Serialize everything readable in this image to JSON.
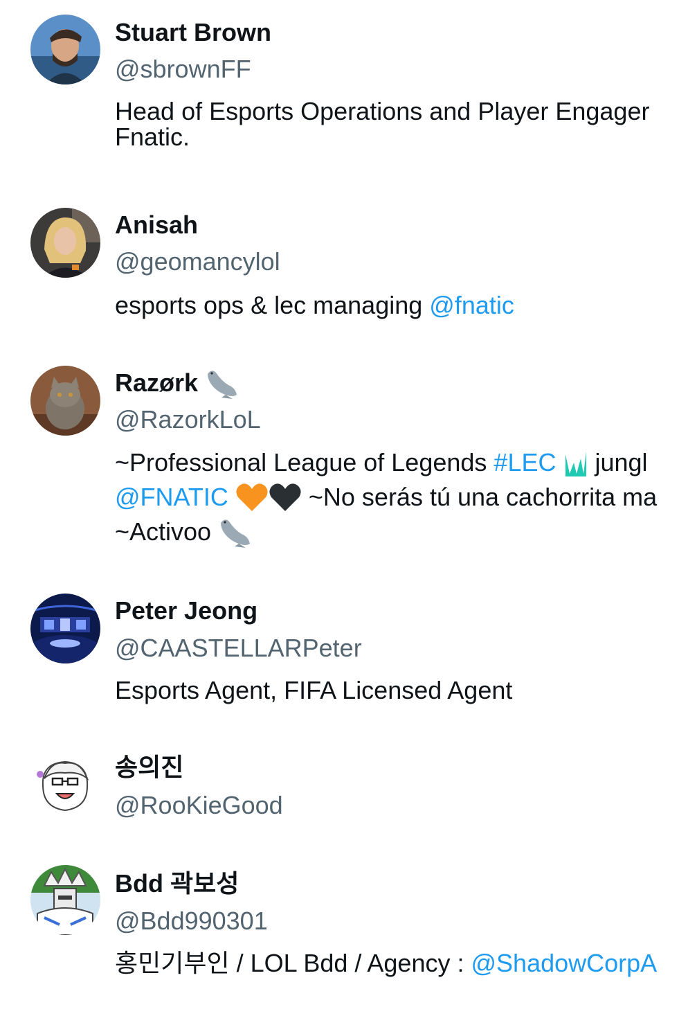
{
  "users": [
    {
      "display_name": "Stuart Brown",
      "handle": "@sbrownFF",
      "bio_lines": [
        "Head of Esports Operations and Player Engager",
        "Fnatic."
      ]
    },
    {
      "display_name": "Anisah",
      "handle": "@geomancylol",
      "bio_text": "esports ops & lec managing ",
      "bio_mention": "@fnatic"
    },
    {
      "display_name": "Razørk",
      "name_emoji": "seal-emoji",
      "handle": "@RazorkLoL",
      "bio_line1_text": "~Professional League of Legends ",
      "bio_line1_hashtag": "#LEC",
      "bio_line1_emoji": "lec-logo-emoji",
      "bio_line1_text2": " jungl",
      "bio_line2_mention": "@FNATIC",
      "bio_line2_emojis": [
        "orange-heart-emoji",
        "black-heart-emoji"
      ],
      "bio_line2_text": " ~No serás tú una cachorrita ma",
      "bio_line3_text": "~Activoo ",
      "bio_line3_emoji": "seal-emoji"
    },
    {
      "display_name": "Peter Jeong",
      "handle": "@CAASTELLARPeter",
      "bio_text": "Esports Agent, FIFA Licensed Agent"
    },
    {
      "display_name": "송의진",
      "handle": "@RooKieGood"
    },
    {
      "display_name": "Bdd 곽보성",
      "handle": "@Bdd990301",
      "bio_text": "홍민기부인 / LOL Bdd / Agency : ",
      "bio_mention": "@ShadowCorpA"
    }
  ],
  "colors": {
    "text_primary": "#0f1419",
    "text_secondary": "#536471",
    "link": "#1d9bf0",
    "background": "#ffffff"
  }
}
